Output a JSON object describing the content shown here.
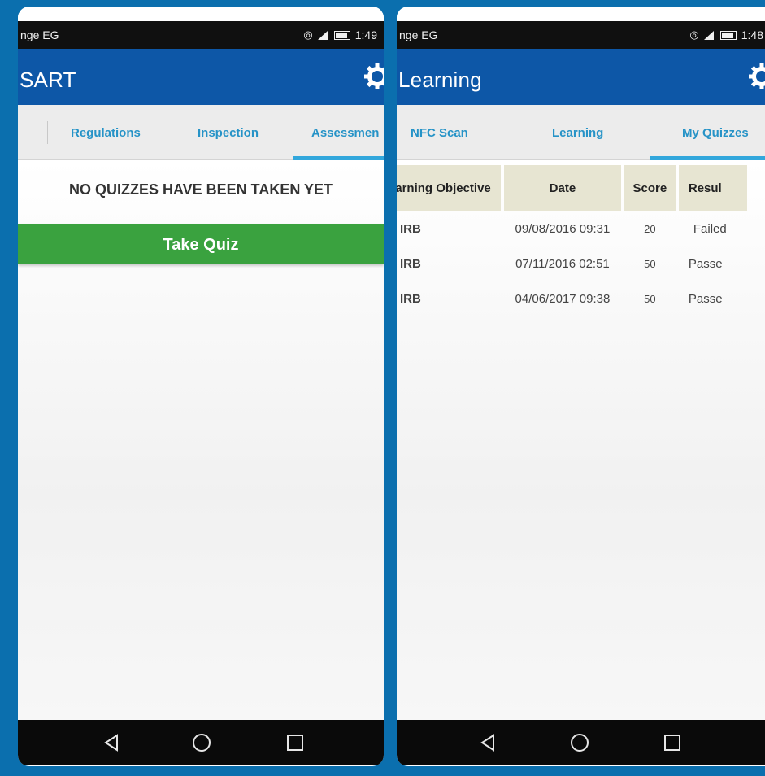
{
  "left_screen": {
    "status": {
      "carrier": "nge EG",
      "time": "1:49"
    },
    "appbar": {
      "title": "SART"
    },
    "tabs": [
      {
        "label": "Regulations",
        "active": false
      },
      {
        "label": "Inspection",
        "active": false
      },
      {
        "label": "Assessmen",
        "active": true
      }
    ],
    "empty_message": "NO QUIZZES HAVE BEEN TAKEN YET",
    "take_quiz_label": "Take Quiz"
  },
  "right_screen": {
    "status": {
      "carrier": "nge EG",
      "time": "1:48"
    },
    "appbar": {
      "title": "Learning"
    },
    "tabs": [
      {
        "label": "NFC Scan",
        "active": false
      },
      {
        "label": "Learning",
        "active": false
      },
      {
        "label": "My Quizzes",
        "active": true
      }
    ],
    "table": {
      "headers": [
        "arning Objective",
        "Date",
        "Score",
        "Resul"
      ],
      "rows": [
        {
          "objective": "IRB",
          "date": "09/08/2016 09:31",
          "score": "20",
          "result": "Failed",
          "status": "failed"
        },
        {
          "objective": "IRB",
          "date": "07/11/2016 02:51",
          "score": "50",
          "result": "Passe",
          "status": "passed"
        },
        {
          "objective": "IRB",
          "date": "04/06/2017 09:38",
          "score": "50",
          "result": "Passe",
          "status": "passed"
        }
      ]
    }
  },
  "colors": {
    "frame": "#0b6fae",
    "appbar": "#0d57a7",
    "tab_text": "#2693c7",
    "tab_underline": "#32a7dc",
    "take_quiz": "#3aa23f",
    "failed": "#d6212e",
    "passed": "#2fb33b"
  },
  "icons": {
    "settings": "gear-icon",
    "nav": [
      "back-triangle-icon",
      "home-circle-icon",
      "recents-square-icon"
    ]
  }
}
